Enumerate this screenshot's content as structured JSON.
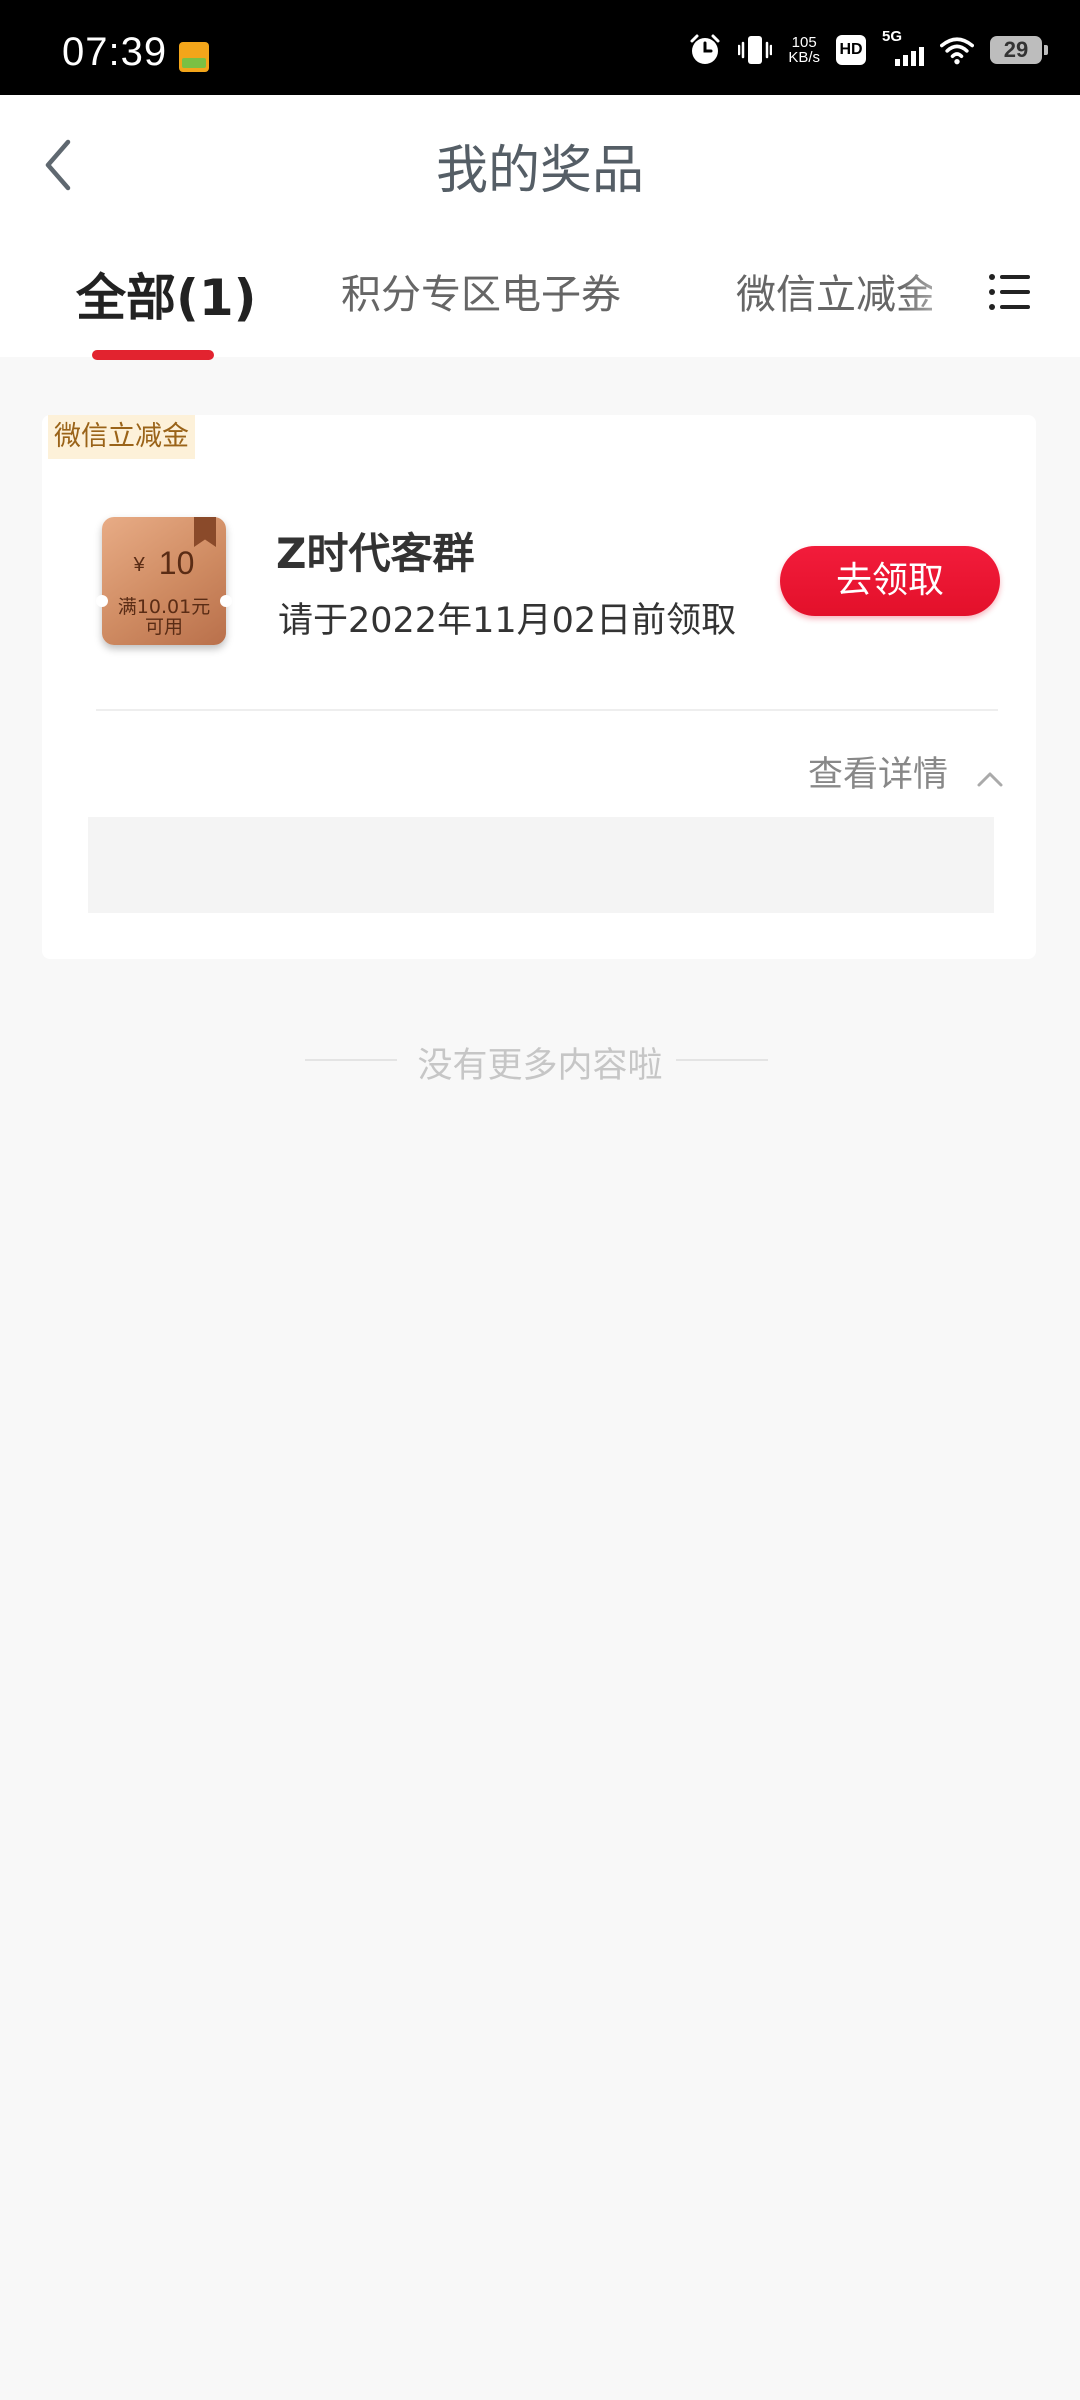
{
  "status_bar": {
    "time": "07:39",
    "speed_value": "105",
    "speed_unit": "KB/s",
    "hd": "HD",
    "network": "5G",
    "battery": "29",
    "icons": [
      "app-icon",
      "alarm-icon",
      "vibrate-icon",
      "wifi-icon",
      "signal-icon",
      "battery-icon"
    ]
  },
  "header": {
    "title": "我的奖品",
    "back_icon": "chevron-left-icon"
  },
  "tabs": {
    "all": "全部(1)",
    "points": "积分专区电子券",
    "wechat": "微信立减金",
    "menu_icon": "list-menu-icon",
    "active": "all"
  },
  "prize_card": {
    "tag": "微信立减金",
    "coupon": {
      "currency": "¥",
      "amount": "10",
      "condition_line1": "满10.01元",
      "condition_line2": "可用"
    },
    "title": "Z时代客群",
    "deadline": "请于2022年11月02日前领取",
    "claim_button": "去领取",
    "details_label": "查看详情"
  },
  "footer": {
    "end_text": "没有更多内容啦"
  },
  "colors": {
    "accent": "#e2232f",
    "tag_bg": "#fdf1d9",
    "tag_text": "#9a6318",
    "background": "#f8f8f8"
  }
}
